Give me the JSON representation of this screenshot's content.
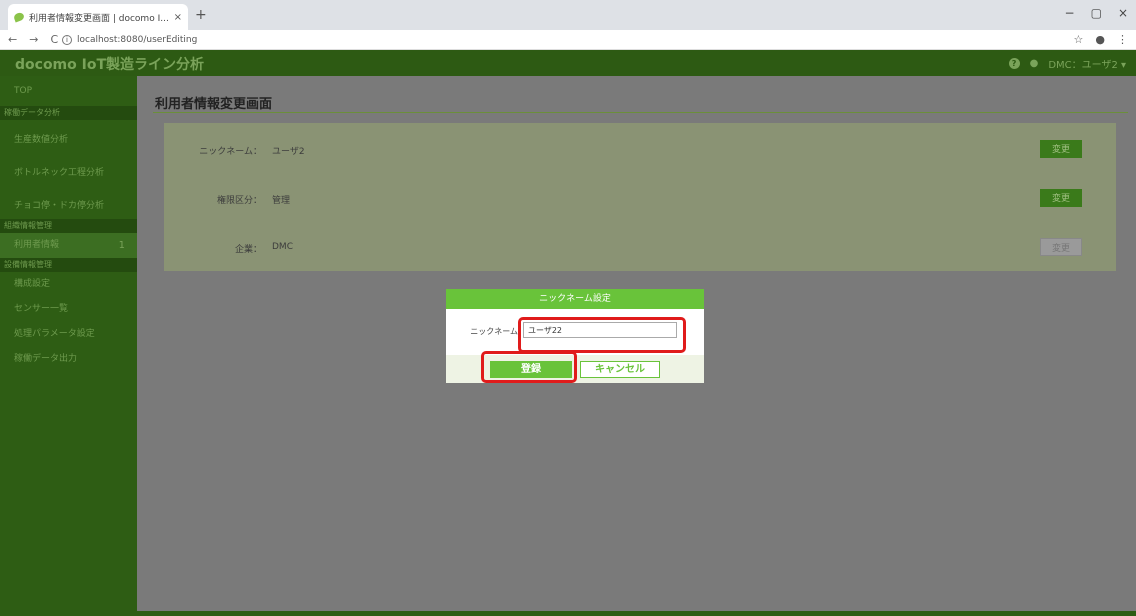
{
  "browser": {
    "tab_title": "利用者情報変更画面 | docomo I...",
    "tab_close": "×",
    "new_tab": "+",
    "url": "localhost:8080/userEditing",
    "window_controls": [
      "−",
      "▢",
      "×"
    ]
  },
  "app": {
    "title": "docomo IoT製造ライン分析",
    "user_menu": "DMC：ユーザ2 ▾",
    "help": "?"
  },
  "sidebar": {
    "top": "TOP",
    "sections": [
      {
        "label": "稼働データ分析",
        "items": [
          "生産数値分析",
          "ボトルネック工程分析",
          "チョコ停・ドカ停分析"
        ]
      },
      {
        "label": "組織情報管理",
        "items": [
          "利用者情報"
        ]
      },
      {
        "label": "設備情報管理",
        "items": [
          "構成設定",
          "センサー一覧",
          "処理パラメータ設定",
          "稼働データ出力"
        ]
      }
    ],
    "active_badge": "1"
  },
  "main": {
    "page_title": "利用者情報変更画面",
    "rows": [
      {
        "label": "ニックネーム：",
        "value": "ユーザ2",
        "button": "変更"
      },
      {
        "label": "権限区分：",
        "value": "管理",
        "button": "変更"
      },
      {
        "label": "企業：",
        "value": "DMC",
        "button": "変更"
      }
    ]
  },
  "modal": {
    "title": "ニックネーム設定",
    "field_label": "ニックネーム",
    "field_value": "ユーザ22",
    "submit": "登録",
    "cancel": "キャンセル"
  }
}
